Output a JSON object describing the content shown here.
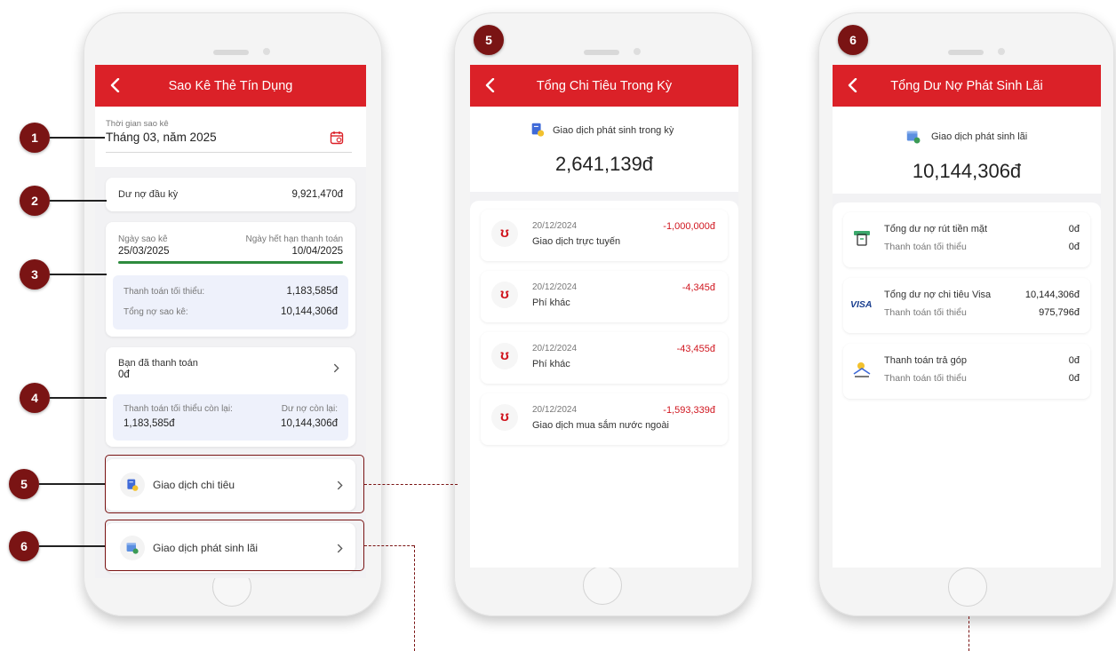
{
  "colors": {
    "brand": "#db2128",
    "badge": "#7a1414",
    "negative": "#d0161f",
    "progress": "#2e8b3e"
  },
  "badges": [
    "1",
    "2",
    "3",
    "4",
    "5",
    "6"
  ],
  "screen1": {
    "title": "Sao Kê Thẻ Tín Dụng",
    "period_label": "Thời gian sao kê",
    "period_value": "Tháng 03, năm 2025",
    "opening_label": "Dư nợ đầu kỳ",
    "opening_value": "9,921,470đ",
    "statement_date_label": "Ngày sao kê",
    "statement_date": "25/03/2025",
    "due_date_label": "Ngày hết hạn thanh toán",
    "due_date": "10/04/2025",
    "min_payment_label": "Thanh toán tối thiểu:",
    "min_payment_value": "1,183,585đ",
    "total_debt_label": "Tổng nợ sao kê:",
    "total_debt_value": "10,144,306đ",
    "paid_label": "Bạn đã thanh toán",
    "paid_value": "0đ",
    "min_remaining_label": "Thanh toán tối thiểu còn lại:",
    "min_remaining_value": "1,183,585đ",
    "debt_remaining_label": "Dư nợ còn lại:",
    "debt_remaining_value": "10,144,306đ",
    "spending_label": "Giao dịch chi tiêu",
    "interest_label": "Giao dịch phát sinh lãi"
  },
  "screen2": {
    "badge": "5",
    "title": "Tổng Chi Tiêu Trong Kỳ",
    "summary_label": "Giao dịch phát sinh trong kỳ",
    "summary_value": "2,641,139đ",
    "transactions": [
      {
        "date": "20/12/2024",
        "desc": "Giao dịch trực tuyến",
        "amount": "-1,000,000đ"
      },
      {
        "date": "20/12/2024",
        "desc": "Phí khác",
        "amount": "-4,345đ"
      },
      {
        "date": "20/12/2024",
        "desc": "Phí khác",
        "amount": "-43,455đ"
      },
      {
        "date": "20/12/2024",
        "desc": "Giao dịch mua sắm nước ngoài",
        "amount": "-1,593,339đ"
      }
    ]
  },
  "screen3": {
    "badge": "6",
    "title": "Tổng Dư Nợ Phát Sinh Lãi",
    "summary_label": "Giao dịch phát sinh lãi",
    "summary_value": "10,144,306đ",
    "items": [
      {
        "label": "Tổng dư nợ rút tiền mặt",
        "value": "0đ",
        "sub_label": "Thanh toán tối thiểu",
        "sub_value": "0đ",
        "icon": "cash-icon"
      },
      {
        "label": "Tổng dư nợ chi tiêu Visa",
        "value": "10,144,306đ",
        "sub_label": "Thanh toán tối thiểu",
        "sub_value": "975,796đ",
        "icon": "visa-icon",
        "icon_text": "VISA"
      },
      {
        "label": "Thanh toán trả góp",
        "value": "0đ",
        "sub_label": "Thanh toán tối thiểu",
        "sub_value": "0đ",
        "icon": "installment-icon"
      }
    ]
  }
}
